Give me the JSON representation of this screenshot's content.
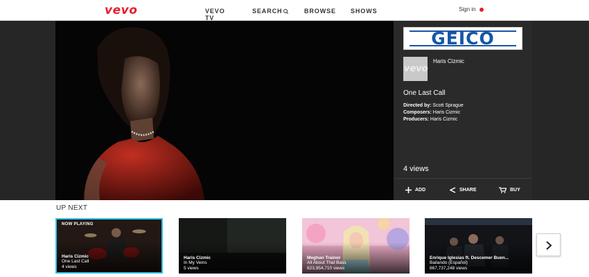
{
  "header": {
    "logo": "vevo",
    "nav": [
      "VEVO TV",
      "SEARCH",
      "BROWSE",
      "SHOWS"
    ],
    "signin": "Sign in"
  },
  "sidebar": {
    "ad_text": "GEICO",
    "artist_thumb_text": "vevo",
    "artist": "Haris Cizmic",
    "title": "One Last Call",
    "credits": [
      {
        "label": "Directed by:",
        "value": "Scott Sprague"
      },
      {
        "label": "Composers:",
        "value": "Haris Cizmic"
      },
      {
        "label": "Producers:",
        "value": "Haris Cizmic"
      }
    ],
    "views": "4 views",
    "actions": {
      "add": "ADD",
      "share": "SHARE",
      "buy": "BUY"
    }
  },
  "upnext": {
    "title": "UP NEXT",
    "now_playing": "NOW PLAYING",
    "cards": [
      {
        "artist": "Haris Cizmic",
        "title": "One Last Call",
        "views": "4 views"
      },
      {
        "artist": "Haris Cizmic",
        "title": "In My Veins",
        "views": "5 views"
      },
      {
        "artist": "Meghan Trainor",
        "title": "All About That Bass",
        "views": "823,954,710 views"
      },
      {
        "artist": "Enrique Iglesias ft. Descemer Buen...",
        "title": "Bailando (Español)",
        "views": "867,737,248 views"
      }
    ]
  },
  "colors": {
    "brand_red": "#e5202e",
    "active_border": "#2ec3e8",
    "ad_blue": "#1656a6"
  }
}
